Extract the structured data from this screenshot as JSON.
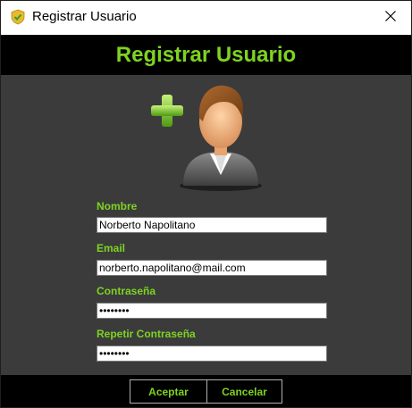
{
  "window": {
    "title": "Registrar Usuario",
    "icon": "shield-check-icon",
    "close_icon": "close-icon"
  },
  "header": {
    "title": "Registrar Usuario"
  },
  "avatar": {
    "icon": "add-user-icon"
  },
  "form": {
    "nombre": {
      "label": "Nombre",
      "value": "Norberto Napolitano"
    },
    "email": {
      "label": "Email",
      "value": "norberto.napolitano@mail.com"
    },
    "password": {
      "label": "Contraseña",
      "value": "12345678"
    },
    "password_repeat": {
      "label": "Repetir Contraseña",
      "value": "12345678"
    }
  },
  "buttons": {
    "accept": "Aceptar",
    "cancel": "Cancelar"
  },
  "colors": {
    "accent": "#7ed321",
    "panel": "#3b3b3b",
    "header_bg": "#000000"
  }
}
